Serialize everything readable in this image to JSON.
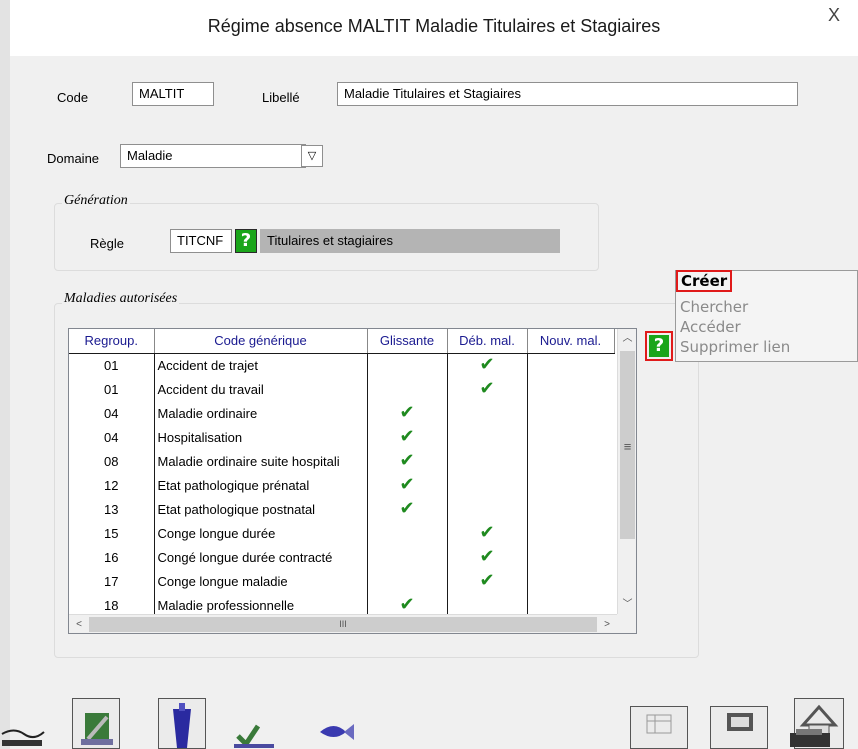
{
  "window": {
    "title": "Régime absence MALTIT Maladie Titulaires et Stagiaires",
    "close_label": "X"
  },
  "form": {
    "code_label": "Code",
    "code_value": "MALTIT",
    "libelle_label": "Libellé",
    "libelle_value": "Maladie Titulaires et Stagiaires",
    "domaine_label": "Domaine",
    "domaine_value": "Maladie",
    "generation_title": "Génération",
    "regle_label": "Règle",
    "regle_code": "TITCNF",
    "regle_desc": "Titulaires et stagiaires",
    "help_glyph": "?"
  },
  "grid": {
    "title": "Maladies autorisées",
    "columns": [
      "Regroup.",
      "Code générique",
      "Glissante",
      "Déb. mal.",
      "Nouv. mal."
    ],
    "rows": [
      {
        "regroup": "01",
        "code": "Accident de trajet",
        "glissante": false,
        "deb": true,
        "nouv": false
      },
      {
        "regroup": "01",
        "code": "Accident du travail",
        "glissante": false,
        "deb": true,
        "nouv": false
      },
      {
        "regroup": "04",
        "code": "Maladie ordinaire",
        "glissante": true,
        "deb": false,
        "nouv": false
      },
      {
        "regroup": "04",
        "code": "Hospitalisation",
        "glissante": true,
        "deb": false,
        "nouv": false
      },
      {
        "regroup": "08",
        "code": "Maladie ordinaire suite hospitali",
        "glissante": true,
        "deb": false,
        "nouv": false
      },
      {
        "regroup": "12",
        "code": "Etat pathologique prénatal",
        "glissante": true,
        "deb": false,
        "nouv": false
      },
      {
        "regroup": "13",
        "code": "Etat pathologique postnatal",
        "glissante": true,
        "deb": false,
        "nouv": false
      },
      {
        "regroup": "15",
        "code": "Conge longue durée",
        "glissante": false,
        "deb": true,
        "nouv": false
      },
      {
        "regroup": "16",
        "code": "Congé longue durée contracté",
        "glissante": false,
        "deb": true,
        "nouv": false
      },
      {
        "regroup": "17",
        "code": "Conge longue maladie",
        "glissante": false,
        "deb": true,
        "nouv": false
      },
      {
        "regroup": "18",
        "code": "Maladie professionnelle",
        "glissante": true,
        "deb": false,
        "nouv": false
      }
    ],
    "check_glyph": "✔",
    "hscroll_grip": "III",
    "vscroll_grip": "≡"
  },
  "context_menu": {
    "items": [
      {
        "label": "Créer",
        "enabled": true
      },
      {
        "label": "Chercher",
        "enabled": false
      },
      {
        "label": "Accéder",
        "enabled": false
      },
      {
        "label": "Supprimer lien",
        "enabled": false
      }
    ]
  },
  "toolbar": {
    "icons": [
      "edit-icon",
      "user-icon",
      "save-icon",
      "sign-icon",
      "fish-icon",
      "grid-icon",
      "print-icon",
      "home-icon",
      "printer-icon"
    ]
  },
  "colors": {
    "help_green": "#1aa51a",
    "check_green": "#1f8a1f",
    "highlight_red": "#e01a1a",
    "header_blue": "#1a1a90"
  }
}
